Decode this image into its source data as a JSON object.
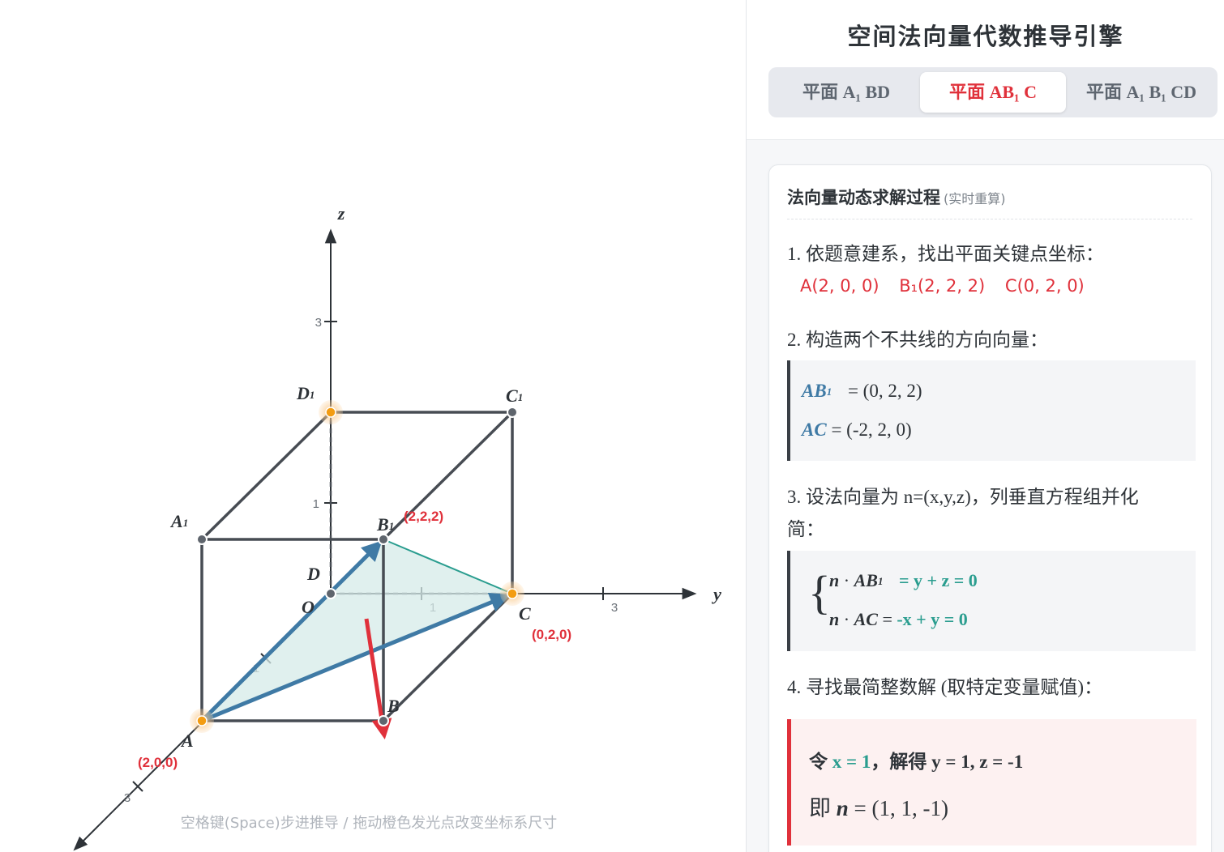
{
  "canvas": {
    "hint": "空格键(Space)步进推导 / 拖动橙色发光点改变坐标系尺寸",
    "axes": {
      "x_tick_1": "1",
      "x_tick_3": "3",
      "y_label": "y",
      "y_tick_1": "1",
      "y_tick_3": "3",
      "z_label": "z",
      "z_tick_1": "1",
      "z_tick_3": "3"
    },
    "points": {
      "O": "O",
      "A": "A",
      "B": "B",
      "C": "C",
      "D": "D",
      "A1": "A",
      "B1": "B",
      "C1": "C",
      "D1": "D",
      "sub": "1"
    },
    "coord_labels": {
      "A": "(2,0,0)",
      "B1": "(2,2,2)",
      "C": "(0,2,0)"
    },
    "colors": {
      "edge": "#474c53",
      "vector": "#3f7aa5",
      "plane_fill": "#d6ebe8",
      "plane_edge": "#2a9d8f",
      "normal": "#e0313b",
      "handle": "#f39c12",
      "coord_text": "#e0313b"
    }
  },
  "panel": {
    "title": "空间法向量代数推导引擎",
    "tabs": [
      {
        "label": "平面 A₁ BD",
        "active": false
      },
      {
        "label": "平面 AB₁ C",
        "active": true
      },
      {
        "label": "平面 A₁ B₁ CD",
        "active": false
      }
    ],
    "card": {
      "title": "法向量动态求解过程",
      "subtitle": "(实时重算)",
      "step1": "1. 依题意建系，找出平面关键点坐标：",
      "points": [
        "A(2, 0, 0)",
        "B₁(2, 2, 2)",
        "C(0, 2, 0)"
      ],
      "step2": "2. 构造两个不共线的方向向量：",
      "vec1_name": "AB",
      "vec1_sub": "1",
      "vec1_value": "= (0, 2, 2)",
      "vec2_name": "AC",
      "vec2_value": "= (-2, 2, 0)",
      "step3": "3. 设法向量为 n=(x,y,z)，列垂直方程组并化简：",
      "eq1_n": "n",
      "eq1_dot": "·",
      "eq1_vec": "AB",
      "eq1_sub": "1",
      "eq1_rhs": "= y + z = 0",
      "eq2_n": "n",
      "eq2_dot": "·",
      "eq2_vec": "AC",
      "eq2_eq": "=",
      "eq2_rhs": "-x + y = 0",
      "brace": "{",
      "step4": "4. 寻找最简整数解 (取特定变量赋值)：",
      "let_prefix": "令",
      "let_value": "x = 1",
      "solve": "，解得 y = 1, z = -1",
      "result_prefix": "即",
      "result_n": "n",
      "result_value": "= (1, 1, -1)"
    }
  }
}
